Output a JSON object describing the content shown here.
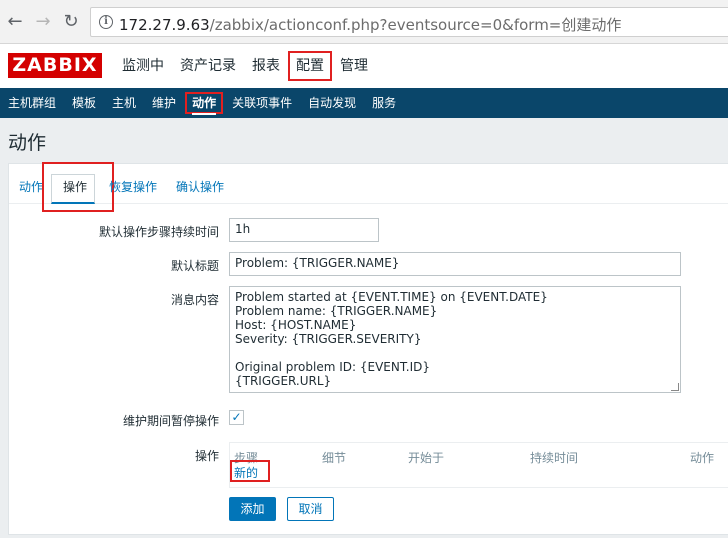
{
  "browser": {
    "url_host": "172.27.9.63",
    "url_path": "/zabbix/actionconf.php?eventsource=0&form=创建动作"
  },
  "header": {
    "logo": "ZABBIX",
    "menu": [
      "监测中",
      "资产记录",
      "报表",
      "配置",
      "管理"
    ],
    "selected_menu": "配置"
  },
  "subnav": {
    "items": [
      "主机群组",
      "模板",
      "主机",
      "维护",
      "动作",
      "关联项事件",
      "自动发现",
      "服务"
    ],
    "selected": "动作"
  },
  "page_title": "动作",
  "tabs": [
    "动作",
    "操作",
    "恢复操作",
    "确认操作"
  ],
  "selected_tab": "操作",
  "form": {
    "step_duration_label": "默认操作步骤持续时间",
    "step_duration_value": "1h",
    "subject_label": "默认标题",
    "subject_value": "Problem: {TRIGGER.NAME}",
    "message_label": "消息内容",
    "message_lines": [
      "Problem started at {EVENT.TIME} on {EVENT.DATE}",
      "Problem name: {TRIGGER.NAME}",
      "Host: {HOST.NAME}",
      "Severity: {TRIGGER.SEVERITY}",
      "",
      "Original problem ID: {EVENT.ID}",
      "{TRIGGER.URL}"
    ],
    "pause_label": "维护期间暂停操作",
    "pause_checked": true,
    "operations_label": "操作",
    "ops_columns": [
      "步骤",
      "细节",
      "开始于",
      "持续时间",
      "动作"
    ],
    "new_link": "新的",
    "add_button": "添加",
    "cancel_button": "取消"
  }
}
